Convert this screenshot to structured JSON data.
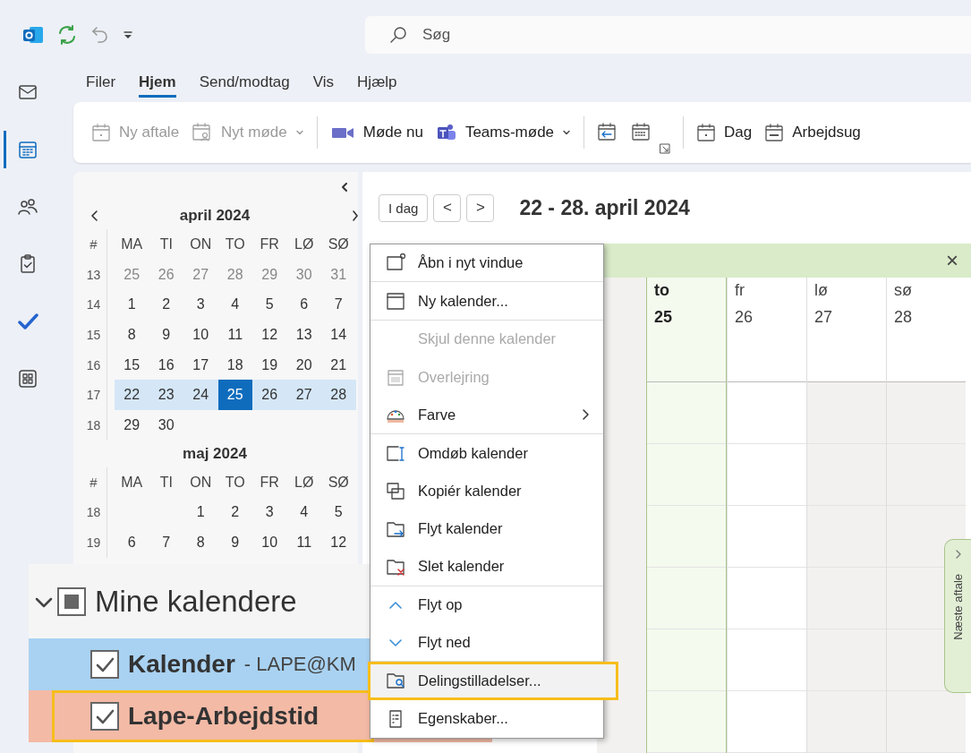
{
  "search": {
    "placeholder": "Søg"
  },
  "nav_rail": [
    {
      "kind": "mail",
      "selected": false
    },
    {
      "kind": "calendar",
      "selected": true
    },
    {
      "kind": "people",
      "selected": false
    },
    {
      "kind": "tasks",
      "selected": false
    },
    {
      "kind": "todo",
      "selected": false
    },
    {
      "kind": "apps",
      "selected": false
    }
  ],
  "menu_tabs": [
    {
      "label": "Filer",
      "selected": false
    },
    {
      "label": "Hjem",
      "selected": true
    },
    {
      "label": "Send/modtag",
      "selected": false
    },
    {
      "label": "Vis",
      "selected": false
    },
    {
      "label": "Hjælp",
      "selected": false
    }
  ],
  "ribbon": [
    {
      "kind": "button",
      "label": "Ny aftale",
      "disabled": true,
      "dropdown": false
    },
    {
      "kind": "button",
      "label": "Nyt møde",
      "disabled": true,
      "dropdown": true
    },
    {
      "kind": "separator"
    },
    {
      "kind": "button",
      "label": "Møde nu",
      "disabled": false,
      "dropdown": false
    },
    {
      "kind": "button",
      "label": "Teams-møde",
      "disabled": false,
      "dropdown": true
    },
    {
      "kind": "separator"
    },
    {
      "kind": "button",
      "disabled": false,
      "dropdown": false
    },
    {
      "kind": "button",
      "disabled": false,
      "dropdown": false
    },
    {
      "kind": "launcher"
    },
    {
      "kind": "separator"
    },
    {
      "kind": "button",
      "label": "Dag",
      "disabled": false,
      "dropdown": false
    },
    {
      "kind": "button",
      "label": "Arbejdsug",
      "disabled": false,
      "dropdown": false
    }
  ],
  "mini_calendar": {
    "months": [
      {
        "title": "april 2024",
        "week_header": "#",
        "weekdays": [
          "MA",
          "TI",
          "ON",
          "TO",
          "FR",
          "LØ",
          "SØ"
        ],
        "weeks": [
          {
            "number": "13",
            "current": false,
            "days": [
              {
                "label": "25",
                "other_month": true,
                "selected": false
              },
              {
                "label": "26",
                "other_month": true,
                "selected": false
              },
              {
                "label": "27",
                "other_month": true,
                "selected": false
              },
              {
                "label": "28",
                "other_month": true,
                "selected": false
              },
              {
                "label": "29",
                "other_month": true,
                "selected": false
              },
              {
                "label": "30",
                "other_month": true,
                "selected": false
              },
              {
                "label": "31",
                "other_month": true,
                "selected": false
              }
            ]
          },
          {
            "number": "14",
            "current": false,
            "days": [
              {
                "label": "1",
                "other_month": false,
                "selected": false
              },
              {
                "label": "2",
                "other_month": false,
                "selected": false
              },
              {
                "label": "3",
                "other_month": false,
                "selected": false
              },
              {
                "label": "4",
                "other_month": false,
                "selected": false
              },
              {
                "label": "5",
                "other_month": false,
                "selected": false
              },
              {
                "label": "6",
                "other_month": false,
                "selected": false
              },
              {
                "label": "7",
                "other_month": false,
                "selected": false
              }
            ]
          },
          {
            "number": "15",
            "current": false,
            "days": [
              {
                "label": "8",
                "other_month": false,
                "selected": false
              },
              {
                "label": "9",
                "other_month": false,
                "selected": false
              },
              {
                "label": "10",
                "other_month": false,
                "selected": false
              },
              {
                "label": "11",
                "other_month": false,
                "selected": false
              },
              {
                "label": "12",
                "other_month": false,
                "selected": false
              },
              {
                "label": "13",
                "other_month": false,
                "selected": false
              },
              {
                "label": "14",
                "other_month": false,
                "selected": false
              }
            ]
          },
          {
            "number": "16",
            "current": false,
            "days": [
              {
                "label": "15",
                "other_month": false,
                "selected": false
              },
              {
                "label": "16",
                "other_month": false,
                "selected": false
              },
              {
                "label": "17",
                "other_month": false,
                "selected": false
              },
              {
                "label": "18",
                "other_month": false,
                "selected": false
              },
              {
                "label": "19",
                "other_month": false,
                "selected": false
              },
              {
                "label": "20",
                "other_month": false,
                "selected": false
              },
              {
                "label": "21",
                "other_month": false,
                "selected": false
              }
            ]
          },
          {
            "number": "17",
            "current": true,
            "days": [
              {
                "label": "22",
                "other_month": false,
                "selected": false
              },
              {
                "label": "23",
                "other_month": false,
                "selected": false
              },
              {
                "label": "24",
                "other_month": false,
                "selected": false
              },
              {
                "label": "25",
                "other_month": false,
                "selected": true
              },
              {
                "label": "26",
                "other_month": false,
                "selected": false
              },
              {
                "label": "27",
                "other_month": false,
                "selected": false
              },
              {
                "label": "28",
                "other_month": false,
                "selected": false
              }
            ]
          },
          {
            "number": "18",
            "current": false,
            "days": [
              {
                "label": "29",
                "other_month": false,
                "selected": false
              },
              {
                "label": "30",
                "other_month": false,
                "selected": false
              }
            ]
          }
        ]
      },
      {
        "title": "maj 2024",
        "week_header": "#",
        "weekdays": [
          "MA",
          "TI",
          "ON",
          "TO",
          "FR",
          "LØ",
          "SØ"
        ],
        "weeks": [
          {
            "number": "18",
            "current": false,
            "kind": "month_start",
            "days": [
              {
                "label": "1",
                "other_month": false,
                "selected": false
              },
              {
                "label": "2",
                "other_month": false,
                "selected": false
              },
              {
                "label": "3",
                "other_month": false,
                "selected": false
              },
              {
                "label": "4",
                "other_month": false,
                "selected": false
              },
              {
                "label": "5",
                "other_month": false,
                "selected": false
              }
            ]
          },
          {
            "number": "19",
            "current": false,
            "days": [
              {
                "label": "6",
                "other_month": false,
                "selected": false
              },
              {
                "label": "7",
                "other_month": false,
                "selected": false
              },
              {
                "label": "8",
                "other_month": false,
                "selected": false
              },
              {
                "label": "9",
                "other_month": false,
                "selected": false
              },
              {
                "label": "10",
                "other_month": false,
                "selected": false
              },
              {
                "label": "11",
                "other_month": false,
                "selected": false
              },
              {
                "label": "12",
                "other_month": false,
                "selected": false
              }
            ]
          }
        ]
      }
    ]
  },
  "week_toolbar": {
    "today": "I dag",
    "prev": "<",
    "next": ">",
    "range": "22 - 28. april 2024"
  },
  "calendar_view": {
    "days": [
      {
        "weekday": "to",
        "date": "25",
        "today": true,
        "weekend": false
      },
      {
        "weekday": "fr",
        "date": "26",
        "today": false,
        "weekend": false
      },
      {
        "weekday": "lø",
        "date": "27",
        "today": false,
        "weekend": true
      },
      {
        "weekday": "sø",
        "date": "28",
        "today": false,
        "weekend": true
      }
    ],
    "close": "×",
    "next_appointment": "Næste aftale"
  },
  "context_menu": [
    {
      "label": "Åbn i nyt vindue",
      "disabled": false,
      "submenu": false,
      "highlighted": false,
      "separator_after": true
    },
    {
      "label": "Ny kalender...",
      "disabled": false,
      "submenu": false,
      "highlighted": false,
      "separator_after": true
    },
    {
      "label": "Skjul denne kalender",
      "disabled": true,
      "submenu": false,
      "highlighted": false,
      "separator_after": false
    },
    {
      "label": "Overlejring",
      "disabled": true,
      "submenu": false,
      "highlighted": false,
      "separator_after": false
    },
    {
      "label": "Farve",
      "disabled": false,
      "submenu": true,
      "highlighted": false,
      "separator_after": true
    },
    {
      "label": "Omdøb kalender",
      "disabled": false,
      "submenu": false,
      "highlighted": false,
      "separator_after": false
    },
    {
      "label": "Kopiér kalender",
      "disabled": false,
      "submenu": false,
      "highlighted": false,
      "separator_after": false
    },
    {
      "label": "Flyt kalender",
      "disabled": false,
      "submenu": false,
      "highlighted": false,
      "separator_after": false
    },
    {
      "label": "Slet kalender",
      "disabled": false,
      "submenu": false,
      "highlighted": false,
      "separator_after": true
    },
    {
      "label": "Flyt op",
      "disabled": false,
      "submenu": false,
      "highlighted": false,
      "separator_after": false
    },
    {
      "label": "Flyt ned",
      "disabled": false,
      "submenu": false,
      "highlighted": false,
      "separator_after": true
    },
    {
      "label": "Delingstilladelser...",
      "disabled": false,
      "submenu": false,
      "highlighted": true,
      "separator_after": true
    },
    {
      "label": "Egenskaber...",
      "disabled": false,
      "submenu": false,
      "highlighted": false,
      "separator_after": false
    }
  ],
  "calendar_list": {
    "group": "Mine kalendere",
    "expanded": true,
    "partial": true,
    "items": [
      {
        "name": "Kalender",
        "account": "- LAPE@KM",
        "checked": true,
        "color": "#a9d2f2",
        "highlighted": false
      },
      {
        "name": "Lape-Arbejdstid",
        "checked": true,
        "color": "#f3baa6",
        "highlighted": true
      }
    ]
  }
}
